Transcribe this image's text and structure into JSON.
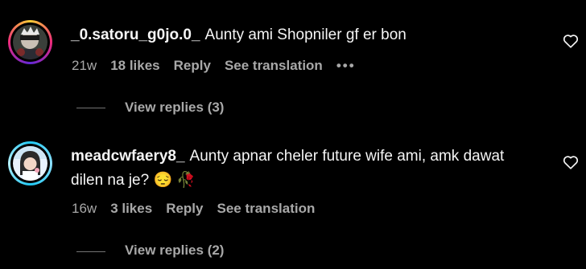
{
  "comments": [
    {
      "username": "_0.satoru_g0jo.0_",
      "text": "Aunty ami Shopniler gf er bon",
      "text_line2": "",
      "age": "21w",
      "likes": "18 likes",
      "reply": "Reply",
      "see_translation": "See translation",
      "more": "•••",
      "view_replies": "View replies (3)"
    },
    {
      "username": "meadcwfaery8_",
      "text": "Aunty apnar cheler future wife ami, amk dawat",
      "text_line2": "dilen na je? 😔 🥀",
      "age": "16w",
      "likes": "3 likes",
      "reply": "Reply",
      "see_translation": "See translation",
      "view_replies": "View replies (2)"
    }
  ],
  "colors": {
    "background": "#000000",
    "primary_text": "#f5f5f5",
    "secondary_text": "#a8a8a8"
  },
  "icons": [
    "heart-icon",
    "more-options-icon",
    "avatar"
  ]
}
